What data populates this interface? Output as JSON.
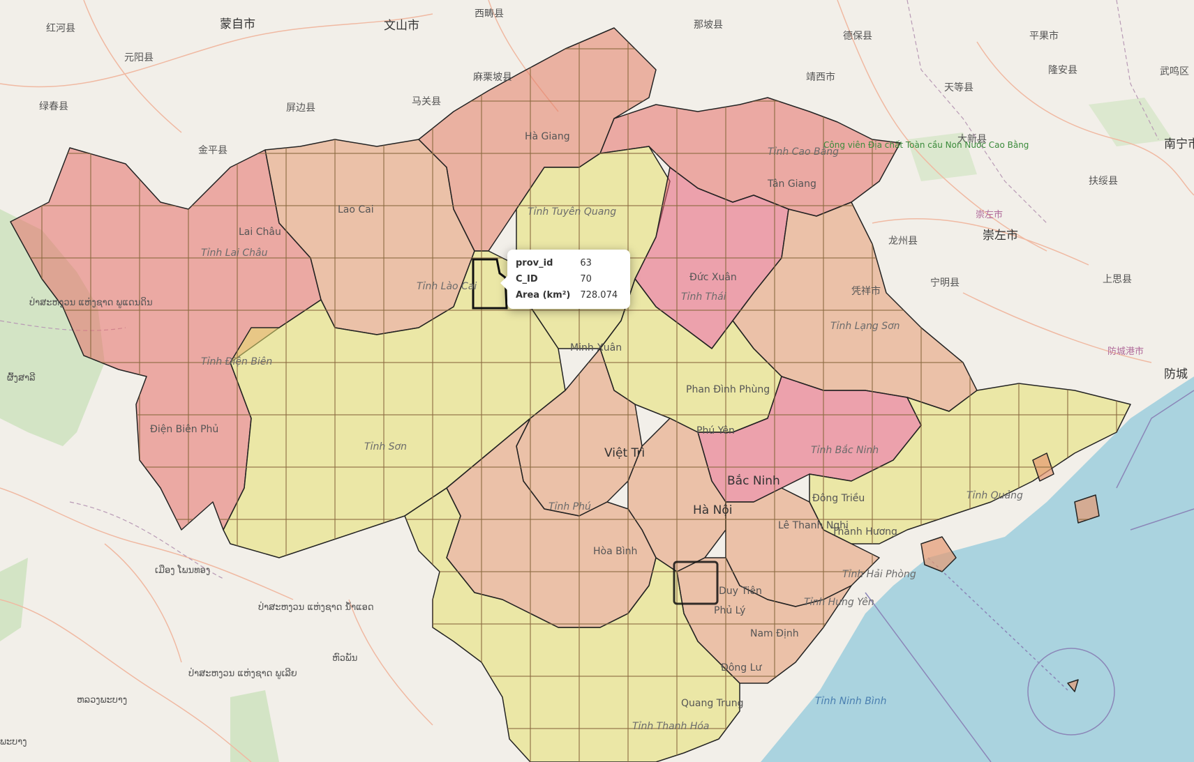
{
  "map": {
    "popup": {
      "rows": [
        {
          "key": "prov_id",
          "value": "63"
        },
        {
          "key": "C_ID",
          "value": "70"
        },
        {
          "key": "Area (km²)",
          "value": "728.074"
        }
      ]
    },
    "colors": {
      "red": "#e5706a",
      "orange": "#e69a72",
      "yellow": "#e6e070",
      "pink": "#e8607a",
      "land": "#f2efe9",
      "sea": "#aad3df",
      "grid_line": "#8a6a40",
      "border": "#222222"
    },
    "labels_china": [
      "红河县",
      "蒙自市",
      "文山市",
      "西畴县",
      "那坡县",
      "德保县",
      "平果市",
      "武鸣区",
      "元阳县",
      "麻栗坡县",
      "马关县",
      "靖西市",
      "天等县",
      "隆安县",
      "绿春县",
      "屏边县",
      "大新县",
      "南宁市",
      "金平县",
      "扶绥县",
      "崇左市",
      "龙州县",
      "崇左市",
      "凭祥市",
      "宁明县",
      "上思县",
      "防城港市",
      "防城"
    ],
    "labels_vietnam": [
      "Hà Giang",
      "Tỉnh Cao Bằng",
      "Tân Giang",
      "Công viên Địa chất Toàn cầu Non Nước Cao Bằng",
      "Lao Cai",
      "Lai Châu",
      "Tỉnh Lai Châu",
      "Tỉnh Tuyên Quang",
      "Đức Xuân",
      "Tỉnh Thái",
      "Tỉnh Lào Cai",
      "Minh Xuân",
      "Tỉnh Lạng Sơn",
      "Tỉnh Điện Biên",
      "Phan Đình Phùng",
      "Điện Biên Phủ",
      "Tỉnh Sơn",
      "Phú Yên",
      "Việt Trì",
      "Tỉnh Bắc Ninh",
      "Bắc Ninh",
      "Tỉnh Phú",
      "Hà Nội",
      "Đông Triều",
      "Tỉnh Quảng",
      "Lê Thanh Nghị",
      "Thành Hương",
      "Hòa Bình",
      "Tỉnh Hải Phòng",
      "Duy Tiên",
      "Phủ Lý",
      "Tỉnh Hưng Yên",
      "Nam Định",
      "Đông Lư",
      "Quang Trung",
      "Tỉnh Thanh Hóa",
      "Tỉnh Ninh Bình"
    ],
    "labels_laos": [
      "ປ່າສະຫງວນ ແຫ່ງຊາດ ພູແດນດິນ",
      "ຜົ້ງສາລີ",
      "ເມືອງ ໂພນທອງ",
      "ປ່າສະຫງວນ ແຫ່ງຊາດ ນ້ຳແອດ",
      "ຫົວພັນ",
      "ປ່າສະຫງວນ ແຫ່ງຊາດ ພູເລີຍ",
      "ຫລວງພະບາງ",
      "ພະບາງ"
    ]
  }
}
